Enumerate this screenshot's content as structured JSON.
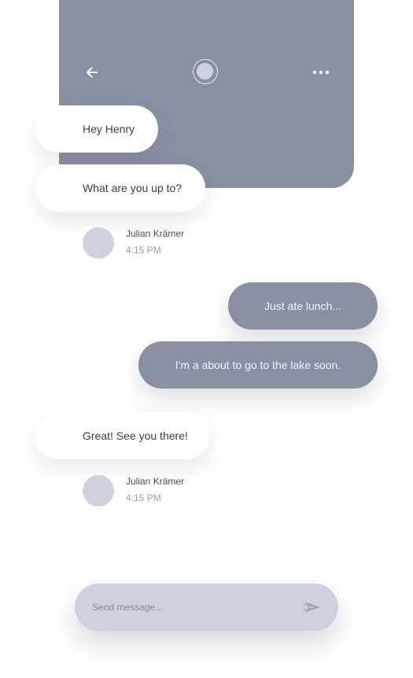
{
  "header": {
    "back_icon": "arrow-left-icon",
    "avatar_icon": "contact-avatar",
    "more_icon": "more-horizontal-icon",
    "bg_color": "#8a90a2"
  },
  "messages": [
    {
      "direction": "incoming",
      "text": "Hey Henry"
    },
    {
      "direction": "incoming",
      "text": "What are you up to?"
    },
    {
      "direction": "outgoing",
      "text": "Just ate lunch..."
    },
    {
      "direction": "outgoing",
      "text": "I'm a about to go to the lake soon."
    },
    {
      "direction": "incoming",
      "text": "Great! See you there!"
    }
  ],
  "meta": [
    {
      "name": "Julian Krämer",
      "time": "4:15 PM"
    },
    {
      "name": "Julian Krämer",
      "time": "4:15 PM"
    }
  ],
  "composer": {
    "placeholder": "Send message...",
    "value": "",
    "send_icon": "send-icon"
  },
  "colors": {
    "accent": "#8a90a2",
    "avatar": "#cfd2de",
    "incoming_bubble": "#ffffff",
    "composer": "#cfd2de"
  }
}
